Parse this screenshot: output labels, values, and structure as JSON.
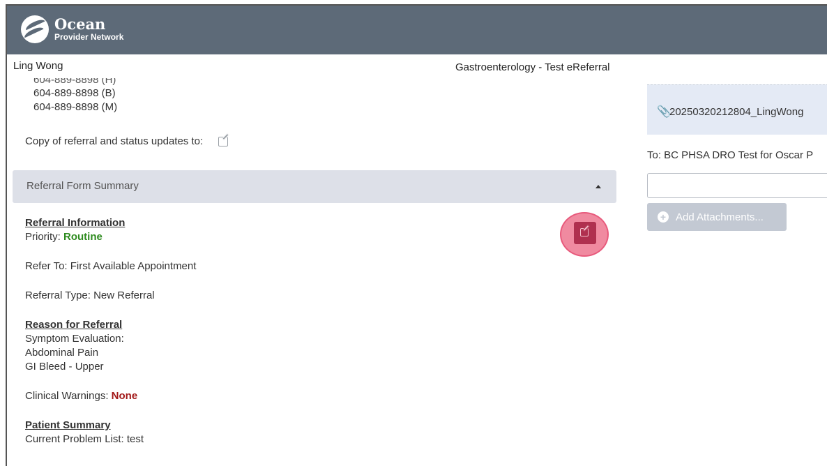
{
  "app": {
    "brand": "Ocean",
    "brand_sub": "Provider Network"
  },
  "header": {
    "patient_name": "Ling Wong",
    "form_title": "Gastroenterology - Test eReferral"
  },
  "phones": {
    "cut": "604-889-8898 (H)",
    "items": [
      "604-889-8898 (B)",
      "604-889-8898 (M)"
    ]
  },
  "copy_row": {
    "label": "Copy of referral and status updates to:"
  },
  "summary": {
    "title": "Referral Form Summary"
  },
  "referral": {
    "info_heading": "Referral Information",
    "priority_label": "Priority: ",
    "priority_value": "Routine",
    "refer_to": "Refer To: First Available Appointment",
    "referral_type": "Referral Type: New Referral",
    "reason_heading": "Reason for Referral",
    "reason_lines": [
      "Symptom Evaluation:",
      "Abdominal Pain",
      "GI Bleed - Upper"
    ],
    "warnings_label": "Clinical Warnings: ",
    "warnings_value": "None",
    "patient_heading": "Patient Summary",
    "problem_list": "Current Problem List: test"
  },
  "right_panel": {
    "attachment_name": "20250320212804_LingWong",
    "to_line": "To: BC PHSA DRO Test for Oscar P",
    "to_input_value": "",
    "add_attachments_label": "Add Attachments..."
  },
  "colors": {
    "topbar": "#5d6a78",
    "priority_green": "#2e8b1f",
    "warning_red": "#a31a1a",
    "highlight": "#f08aa0",
    "edit_button": "#b0304f"
  }
}
